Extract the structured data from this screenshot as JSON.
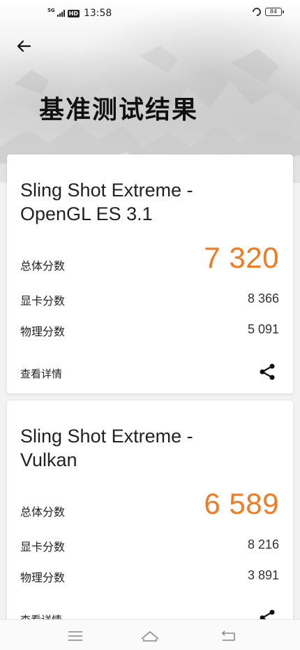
{
  "status_bar": {
    "network": "5G",
    "hd_badge": "HD",
    "time": "13:58",
    "battery": "84"
  },
  "header": {
    "title": "基准测试结果"
  },
  "cards": [
    {
      "title_line1": "Sling Shot Extreme -",
      "title_line2": "OpenGL ES 3.1",
      "total_label": "总体分数",
      "total_value": "7 320",
      "graphics_label": "显卡分数",
      "graphics_value": "8 366",
      "physics_label": "物理分数",
      "physics_value": "5 091",
      "detail_label": "查看详情"
    },
    {
      "title_line1": "Sling Shot Extreme -",
      "title_line2": "Vulkan",
      "total_label": "总体分数",
      "total_value": "6 589",
      "graphics_label": "显卡分数",
      "graphics_value": "8 216",
      "physics_label": "物理分数",
      "physics_value": "3 891",
      "detail_label": "查看详情"
    }
  ],
  "colors": {
    "accent": "#f07b24",
    "card_bg": "#ffffff",
    "page_bg": "#f2f2f2"
  },
  "icons": {
    "back": "arrow-left-icon",
    "share": "share-icon",
    "menu": "menu-icon",
    "home": "home-icon",
    "back_nav": "back-nav-icon"
  }
}
